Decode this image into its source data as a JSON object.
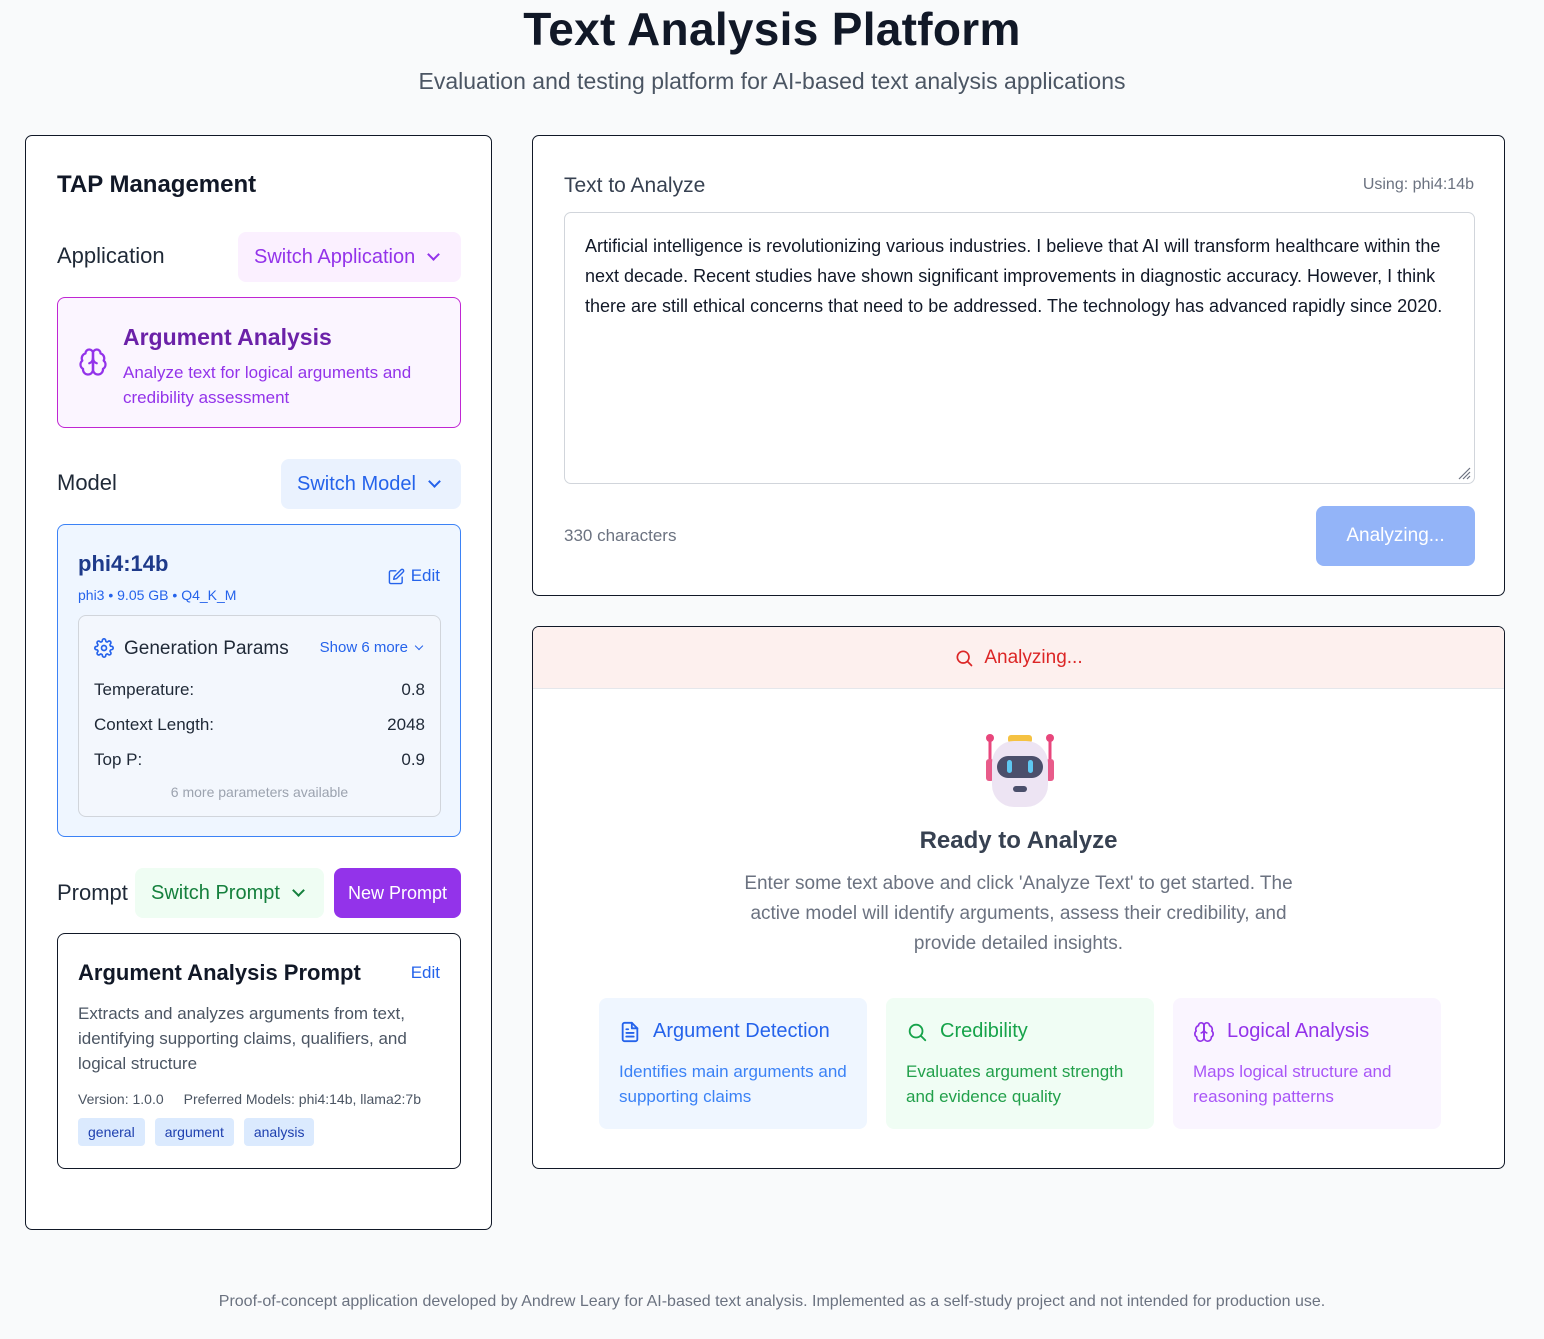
{
  "header": {
    "title": "Text Analysis Platform",
    "subtitle": "Evaluation and testing platform for AI-based text analysis applications"
  },
  "management": {
    "title": "TAP Management",
    "application": {
      "label": "Application",
      "switch_label": "Switch Application",
      "name": "Argument Analysis",
      "description": "Analyze text for logical arguments and credibility assessment",
      "icon": "brain-icon"
    },
    "model": {
      "label": "Model",
      "switch_label": "Switch Model",
      "name": "phi4:14b",
      "meta": "phi3 • 9.05 GB • Q4_K_M",
      "edit_label": "Edit",
      "params": {
        "title": "Generation Params",
        "show_more": "Show 6 more",
        "rows": [
          {
            "label": "Temperature:",
            "value": "0.8"
          },
          {
            "label": "Context Length:",
            "value": "2048"
          },
          {
            "label": "Top P:",
            "value": "0.9"
          }
        ],
        "available": "6 more parameters available"
      }
    },
    "prompt": {
      "label": "Prompt",
      "switch_label": "Switch Prompt",
      "new_label": "New Prompt",
      "name": "Argument Analysis Prompt",
      "edit_label": "Edit",
      "description": "Extracts and analyzes arguments from text, identifying supporting claims, qualifiers, and logical structure",
      "version": "Version: 1.0.0",
      "preferred": "Preferred Models: phi4:14b, llama2:7b",
      "tags": [
        "general",
        "argument",
        "analysis"
      ]
    }
  },
  "input": {
    "label": "Text to Analyze",
    "using": "Using: phi4:14b",
    "text": "Artificial intelligence is revolutionizing various industries. I believe that AI will transform healthcare within the next decade. Recent studies have shown significant improvements in diagnostic accuracy. However, I think there are still ethical concerns that need to be addressed. The technology has advanced rapidly since 2020.",
    "char_count": "330 characters",
    "button_label": "Analyzing..."
  },
  "results": {
    "status": "Analyzing...",
    "ready_title": "Ready to Analyze",
    "ready_desc": "Enter some text above and click 'Analyze Text' to get started. The active model will identify arguments, assess their credibility, and provide detailed insights.",
    "features": [
      {
        "title": "Argument Detection",
        "desc": "Identifies main arguments and supporting claims",
        "icon": "document-icon",
        "color": "#2563eb",
        "bg": "#eff6ff"
      },
      {
        "title": "Credibility",
        "desc": "Evaluates argument strength and evidence quality",
        "icon": "search-icon",
        "color": "#16a34a",
        "bg": "#f0fdf4"
      },
      {
        "title": "Logical Analysis",
        "desc": "Maps logical structure and reasoning patterns",
        "icon": "brain-icon",
        "color": "#9333ea",
        "bg": "#faf5ff"
      }
    ]
  },
  "footer": {
    "text": "Proof-of-concept application developed by Andrew Leary for AI-based text analysis. Implemented as a self-study project and not intended for production use."
  },
  "colors": {
    "purple_accent": "#9333ea",
    "blue_accent": "#2563eb",
    "green_accent": "#16a34a",
    "danger": "#dc2626"
  }
}
